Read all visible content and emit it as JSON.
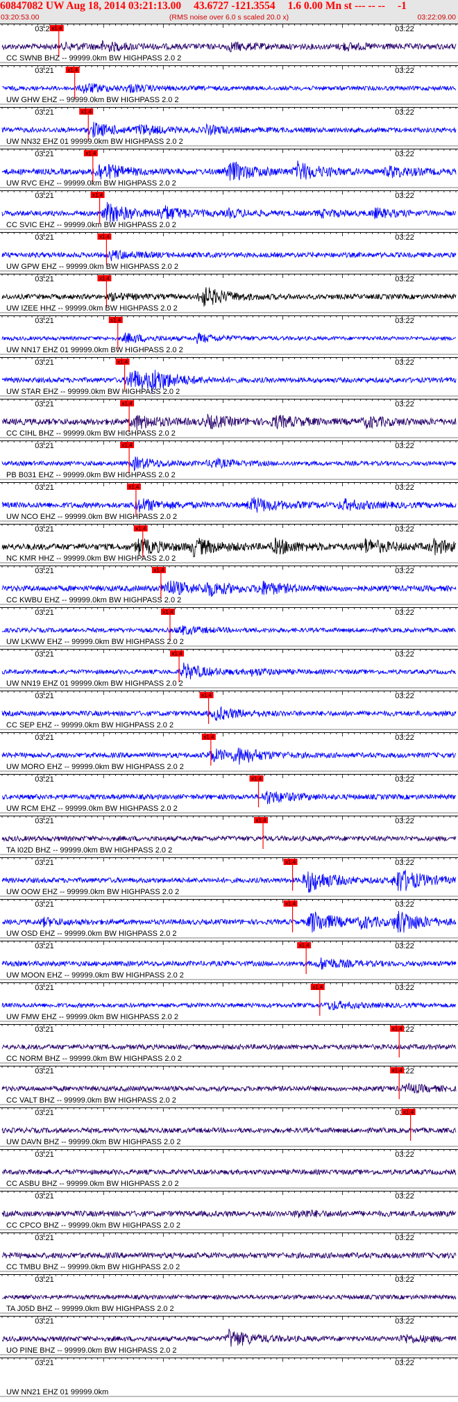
{
  "header": {
    "title_parts": [
      "60847082 UW Aug 18, 2014 03:21:13.00",
      "43.6727 -121.3554",
      "1.6 0.00 Mn st --- -- --",
      "-1"
    ],
    "start_time": "03:20:53.00",
    "note": "(RMS noise over 6.0 s scaled 20.0 x)",
    "end_time": "03:22:09.00"
  },
  "tick_labels": [
    "03:21",
    "03:22"
  ],
  "pick_label": "x1.4",
  "colors": {
    "header_text": "#ff0000",
    "header_bg": "#e6e6e6",
    "pick": "#ff0000",
    "trace_blue": "#0000ff",
    "trace_navy": "#26006b",
    "trace_black": "#000000",
    "grid": "#000000"
  },
  "traces": [
    {
      "label": "CC SWNB BHZ -- 99999.0km BW HIGHPASS 2.0 2",
      "color": "trace_navy",
      "pick": 0.125,
      "amp": 0.45,
      "events": [
        [
          0.14,
          0.35
        ],
        [
          0.22,
          0.55
        ],
        [
          0.5,
          0.5
        ],
        [
          0.75,
          0.4
        ]
      ]
    },
    {
      "label": "UW GHW EHZ -- 99999.0km BW HIGHPASS 2.0 2",
      "color": "trace_blue",
      "pick": 0.16,
      "amp": 0.35,
      "events": [
        [
          0.18,
          0.7
        ],
        [
          0.28,
          0.4
        ]
      ]
    },
    {
      "label": "UW NN32 EHZ 01 99999.0km BW HIGHPASS 2.0 2",
      "color": "trace_blue",
      "pick": 0.19,
      "amp": 0.4,
      "events": [
        [
          0.2,
          1.0
        ],
        [
          0.3,
          0.6
        ],
        [
          0.45,
          0.5
        ]
      ]
    },
    {
      "label": "UW RVC EHZ -- 99999.0km BW HIGHPASS 2.0 2",
      "color": "trace_blue",
      "pick": 0.2,
      "amp": 0.45,
      "events": [
        [
          0.21,
          1.3
        ],
        [
          0.5,
          1.5
        ],
        [
          0.65,
          1.3
        ],
        [
          0.85,
          0.8
        ]
      ]
    },
    {
      "label": "CC SVIC EHZ -- 99999.0km BW HIGHPASS 2.0 2",
      "color": "trace_blue",
      "pick": 0.215,
      "amp": 0.4,
      "events": [
        [
          0.23,
          1.5
        ],
        [
          0.35,
          1.0
        ],
        [
          0.5,
          0.45
        ],
        [
          0.7,
          0.5
        ],
        [
          0.82,
          0.6
        ]
      ]
    },
    {
      "label": "UW GPW EHZ -- 99999.0km BW HIGHPASS 2.0 2",
      "color": "trace_blue",
      "pick": 0.23,
      "amp": 0.4,
      "events": [
        [
          0.24,
          0.6
        ]
      ]
    },
    {
      "label": "UW IZEE HHZ -- 99999.0km BW HIGHPASS 2.0 2",
      "color": "trace_black",
      "pick": 0.23,
      "amp": 0.4,
      "events": [
        [
          0.24,
          0.4
        ],
        [
          0.44,
          1.5
        ]
      ]
    },
    {
      "label": "UW NN17 EHZ 01 99999.0km BW HIGHPASS 2.0 2",
      "color": "trace_blue",
      "pick": 0.255,
      "amp": 0.3,
      "events": [
        [
          0.27,
          0.7
        ],
        [
          0.43,
          0.6
        ]
      ]
    },
    {
      "label": "UW STAR EHZ -- 99999.0km BW HIGHPASS 2.0 2",
      "color": "trace_blue",
      "pick": 0.27,
      "amp": 0.4,
      "events": [
        [
          0.28,
          1.7
        ],
        [
          0.33,
          1.2
        ]
      ]
    },
    {
      "label": "CC CIHL BHZ -- 99999.0km BW HIGHPASS 2.0 2",
      "color": "trace_navy",
      "pick": 0.28,
      "amp": 0.5,
      "events": [
        [
          0.29,
          1.0
        ],
        [
          0.45,
          0.8
        ],
        [
          0.6,
          0.8
        ],
        [
          0.8,
          0.7
        ]
      ]
    },
    {
      "label": "PB B031 EHZ -- 99999.0km BW HIGHPASS 2.0 2",
      "color": "trace_blue",
      "pick": 0.28,
      "amp": 0.35,
      "events": [
        [
          0.29,
          0.9
        ],
        [
          0.46,
          0.6
        ]
      ]
    },
    {
      "label": "UW NCO EHZ -- 99999.0km BW HIGHPASS 2.0 2",
      "color": "trace_blue",
      "pick": 0.295,
      "amp": 0.45,
      "events": [
        [
          0.3,
          0.9
        ],
        [
          0.55,
          1.1
        ],
        [
          0.75,
          0.7
        ]
      ]
    },
    {
      "label": "NC KMR HHZ -- 99999.0km BW HIGHPASS 2.0 2",
      "color": "trace_black",
      "pick": 0.31,
      "amp": 0.5,
      "events": [
        [
          0.3,
          1.1
        ],
        [
          0.42,
          1.2
        ],
        [
          0.6,
          1.0
        ],
        [
          0.8,
          1.0
        ],
        [
          0.95,
          0.9
        ]
      ]
    },
    {
      "label": "CC KWBU EHZ -- 99999.0km BW HIGHPASS 2.0 2",
      "color": "trace_blue",
      "pick": 0.35,
      "amp": 0.45,
      "events": [
        [
          0.36,
          1.2
        ],
        [
          0.45,
          0.9
        ],
        [
          0.57,
          0.9
        ]
      ]
    },
    {
      "label": "UW LKWW EHZ -- 99999.0km BW HIGHPASS 2.0 2",
      "color": "trace_blue",
      "pick": 0.37,
      "amp": 0.35,
      "events": [
        [
          0.39,
          0.6
        ]
      ]
    },
    {
      "label": "UW NN19 EHZ 01 99999.0km BW HIGHPASS 2.0 2",
      "color": "trace_blue",
      "pick": 0.39,
      "amp": 0.35,
      "events": [
        [
          0.4,
          1.2
        ],
        [
          0.55,
          0.4
        ]
      ]
    },
    {
      "label": "CC SEP EHZ -- 99999.0km BW HIGHPASS 2.0 2",
      "color": "trace_blue",
      "pick": 0.455,
      "amp": 0.4,
      "events": [
        [
          0.47,
          0.9
        ]
      ]
    },
    {
      "label": "UW MORO EHZ -- 99999.0km BW HIGHPASS 2.0 2",
      "color": "trace_blue",
      "pick": 0.46,
      "amp": 0.4,
      "events": [
        [
          0.46,
          0.9
        ],
        [
          0.52,
          1.0
        ]
      ]
    },
    {
      "label": "UW RCM EHZ -- 99999.0km BW HIGHPASS 2.0 2",
      "color": "trace_blue",
      "pick": 0.565,
      "amp": 0.4,
      "events": [
        [
          0.58,
          1.0
        ]
      ]
    },
    {
      "label": "TA I02D BHZ -- 99999.0km BW HIGHPASS 2.0 2",
      "color": "trace_navy",
      "pick": 0.575,
      "amp": 0.4,
      "events": []
    },
    {
      "label": "UW OOW EHZ -- 99999.0km BW HIGHPASS 2.0 2",
      "color": "trace_blue",
      "pick": 0.64,
      "amp": 0.4,
      "events": [
        [
          0.67,
          1.9
        ],
        [
          0.87,
          1.9
        ]
      ]
    },
    {
      "label": "UW OSD EHZ -- 99999.0km BW HIGHPASS 2.0 2",
      "color": "trace_blue",
      "pick": 0.64,
      "amp": 0.4,
      "events": [
        [
          0.09,
          0.5
        ],
        [
          0.68,
          1.7
        ],
        [
          0.79,
          0.7
        ],
        [
          0.87,
          1.7
        ]
      ]
    },
    {
      "label": "UW MOON EHZ -- 99999.0km BW HIGHPASS 2.0 2",
      "color": "trace_blue",
      "pick": 0.67,
      "amp": 0.4,
      "events": [
        [
          0.7,
          0.8
        ]
      ]
    },
    {
      "label": "UW FMW EHZ -- 99999.0km BW HIGHPASS 2.0 2",
      "color": "trace_blue",
      "pick": 0.7,
      "amp": 0.35,
      "events": [
        [
          0.72,
          0.6
        ]
      ]
    },
    {
      "label": "CC NORM BHZ -- 99999.0km BW HIGHPASS 2.0 2",
      "color": "trace_navy",
      "pick": 0.875,
      "amp": 0.4,
      "events": []
    },
    {
      "label": "CC VALT BHZ -- 99999.0km BW HIGHPASS 2.0 2",
      "color": "trace_navy",
      "pick": 0.875,
      "amp": 0.4,
      "events": [
        [
          0.89,
          0.6
        ]
      ]
    },
    {
      "label": "UW DAVN BHZ -- 99999.0km BW HIGHPASS 2.0 2",
      "color": "trace_navy",
      "pick": 0.9,
      "amp": 0.4,
      "events": []
    },
    {
      "label": "CC ASBU BHZ -- 99999.0km BW HIGHPASS 2.0 2",
      "color": "trace_navy",
      "pick": null,
      "amp": 0.4,
      "events": []
    },
    {
      "label": "CC CPCO BHZ -- 99999.0km BW HIGHPASS 2.0 2",
      "color": "trace_navy",
      "pick": null,
      "amp": 0.45,
      "events": [
        [
          0.65,
          0.4
        ]
      ]
    },
    {
      "label": "CC TMBU BHZ -- 99999.0km BW HIGHPASS 2.0 2",
      "color": "trace_navy",
      "pick": null,
      "amp": 0.45,
      "events": []
    },
    {
      "label": "TA J05D BHZ -- 99999.0km BW HIGHPASS 2.0 2",
      "color": "trace_navy",
      "pick": null,
      "amp": 0.35,
      "events": []
    },
    {
      "label": "UO PINE BHZ -- 99999.0km BW HIGHPASS 2.0 2",
      "color": "trace_navy",
      "pick": null,
      "amp": 0.4,
      "events": [
        [
          0.5,
          1.3
        ],
        [
          0.88,
          0.6
        ]
      ]
    },
    {
      "label": "UW NN21 EHZ 01 99999.0km",
      "color": "trace_navy",
      "pick": null,
      "amp": 0.0,
      "events": []
    }
  ]
}
